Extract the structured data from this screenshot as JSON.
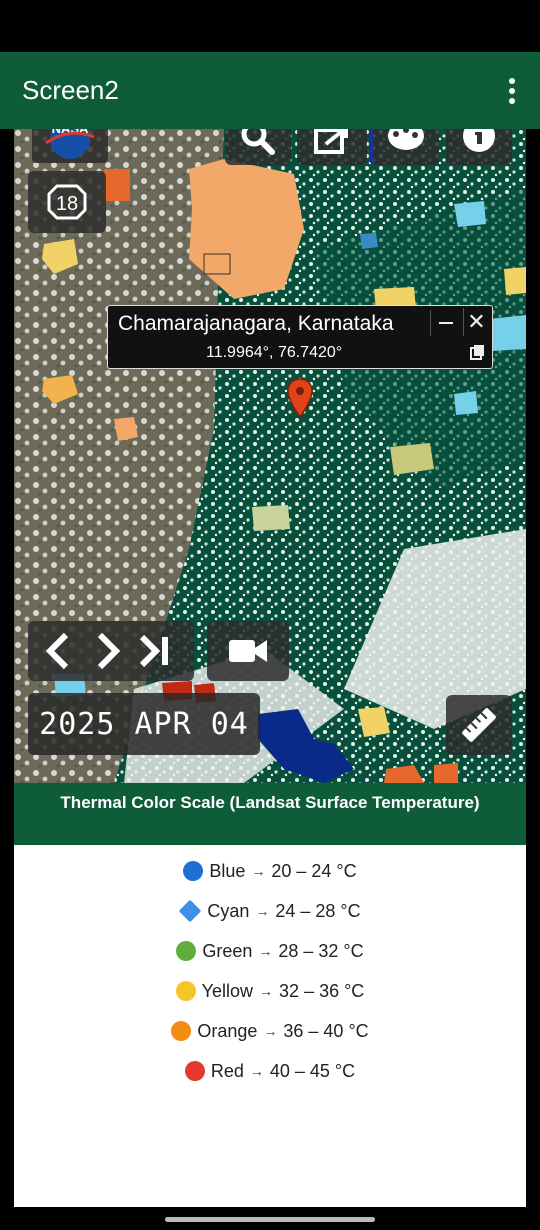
{
  "app": {
    "title": "Screen2"
  },
  "map": {
    "zoom_level": "18",
    "popup": {
      "place": "Chamarajanagara, Karnataka",
      "coordinates": "11.9964°, 76.7420°"
    },
    "date": "2025 APR 04",
    "icons": [
      "nasa-logo",
      "search-icon",
      "share-icon",
      "palette-icon",
      "info-icon",
      "chevron-left-icon",
      "chevron-right-icon",
      "skip-end-icon",
      "video-icon",
      "ruler-icon",
      "location-pin-icon",
      "copy-icon",
      "minimize-icon",
      "close-icon"
    ]
  },
  "scale": {
    "title": "Thermal Color Scale (Landsat Surface Temperature)",
    "items": [
      {
        "symbol": "🔵",
        "name": "Blue",
        "range": "20 – 24 °C",
        "color": "#1d6fd6"
      },
      {
        "symbol": "🔷",
        "name": "Cyan",
        "range": "24 – 28 °C",
        "color": "#3f8ee8"
      },
      {
        "symbol": "🟢",
        "name": "Green",
        "range": "28 – 32 °C",
        "color": "#5fae3a"
      },
      {
        "symbol": "🟡",
        "name": "Yellow",
        "range": "32 – 36 °C",
        "color": "#f6c52a"
      },
      {
        "symbol": "🟠",
        "name": "Orange",
        "range": "36 – 40 °C",
        "color": "#f28c12"
      },
      {
        "symbol": "🔴",
        "name": "Red",
        "range": "40 – 45 °C",
        "color": "#e13a2c"
      }
    ],
    "arrow": "→"
  },
  "colors": {
    "app_bar": "#0f5c39",
    "map_green": "#06503c"
  }
}
